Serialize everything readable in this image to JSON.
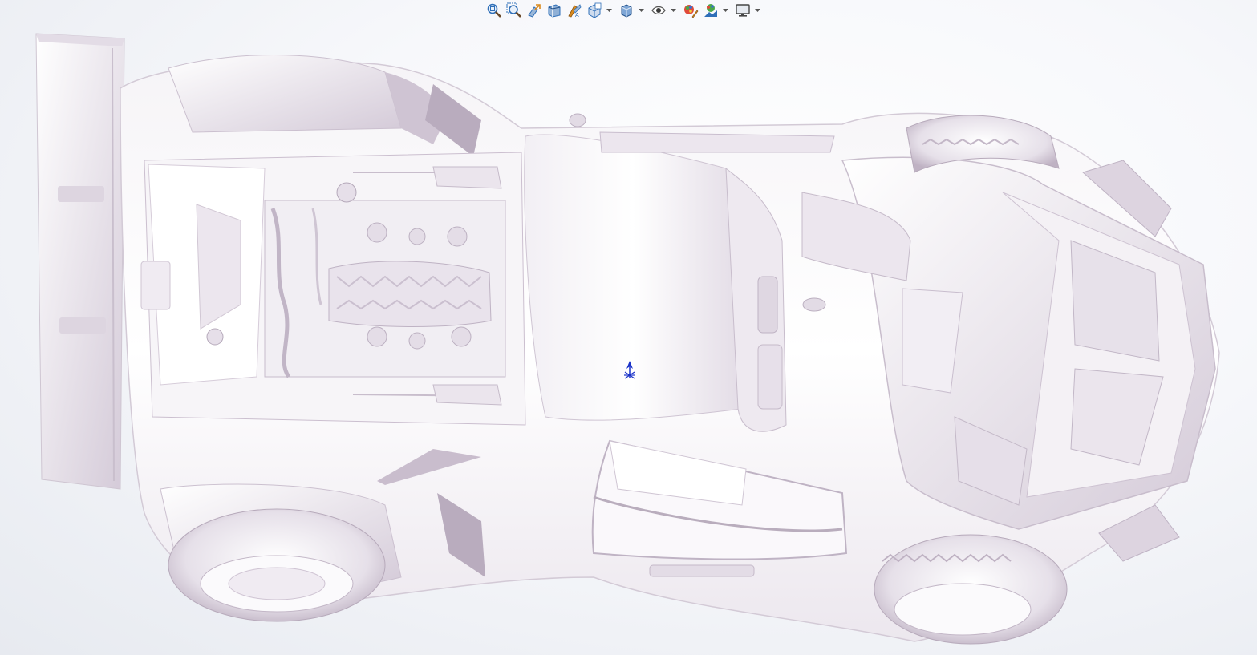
{
  "hud_toolbar": {
    "items": [
      {
        "icon": "zoom-to-fit-icon",
        "has_menu": false
      },
      {
        "icon": "zoom-to-area-icon",
        "has_menu": false
      },
      {
        "icon": "previous-view-icon",
        "has_menu": false
      },
      {
        "icon": "section-view-icon",
        "has_menu": false
      },
      {
        "icon": "dynamic-annotation-view-icon",
        "has_menu": false
      },
      {
        "icon": "view-orientation-icon",
        "has_menu": true
      },
      {
        "icon": "display-style-icon",
        "has_menu": true
      },
      {
        "icon": "hide-show-items-icon",
        "has_menu": true
      },
      {
        "icon": "edit-appearance-icon",
        "has_menu": false
      },
      {
        "icon": "apply-scene-icon",
        "has_menu": true
      },
      {
        "icon": "view-settings-icon",
        "has_menu": true
      }
    ]
  },
  "colors": {
    "model_base": "#f3f1f4",
    "model_shade": "#d9d1dd",
    "model_dark": "#b7a9bb",
    "triad_blue": "#1b33c9",
    "hud_blue": "#2f6fb8",
    "hud_orange": "#d98a1e"
  }
}
